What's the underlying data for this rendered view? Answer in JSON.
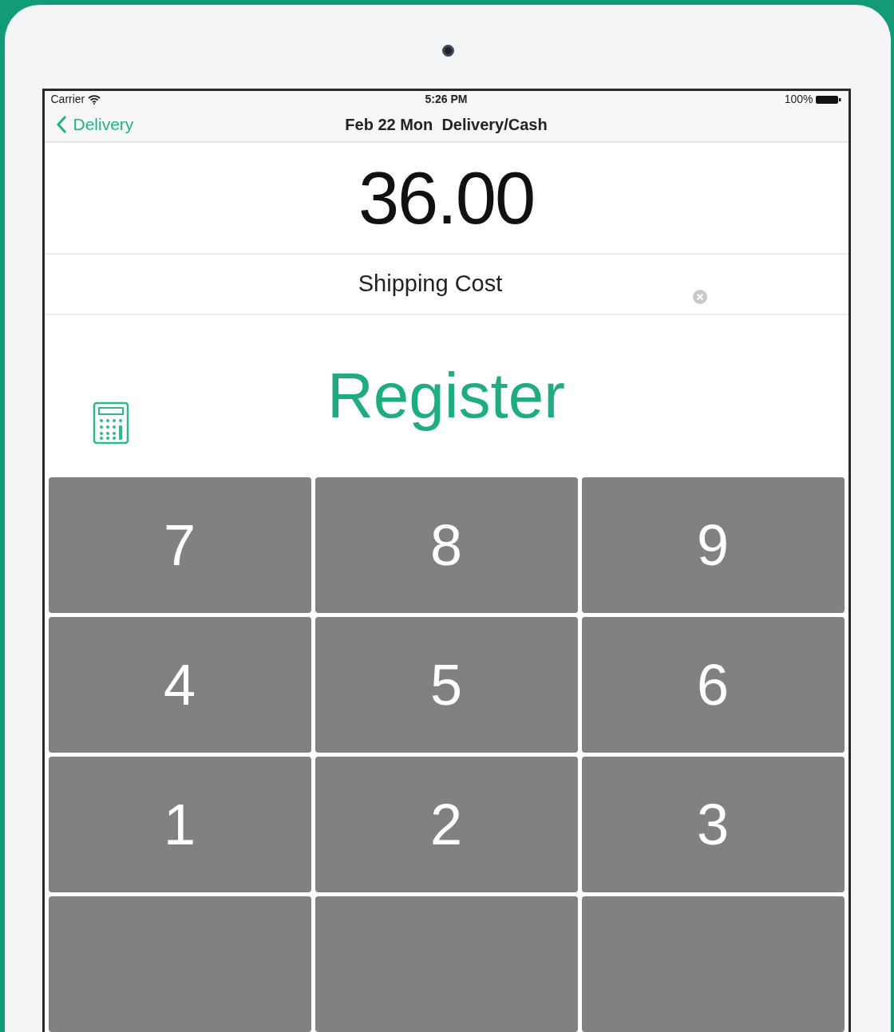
{
  "status_bar": {
    "carrier": "Carrier",
    "time": "5:26 PM",
    "battery": "100%"
  },
  "nav_bar": {
    "back": "Delivery",
    "title": "Feb 22 Mon  Delivery/Cash"
  },
  "amount": "36.00",
  "field": {
    "value": "Shipping Cost"
  },
  "register_button": "Register",
  "keypad": [
    [
      "7",
      "8",
      "9"
    ],
    [
      "4",
      "5",
      "6"
    ],
    [
      "1",
      "2",
      "3"
    ]
  ]
}
